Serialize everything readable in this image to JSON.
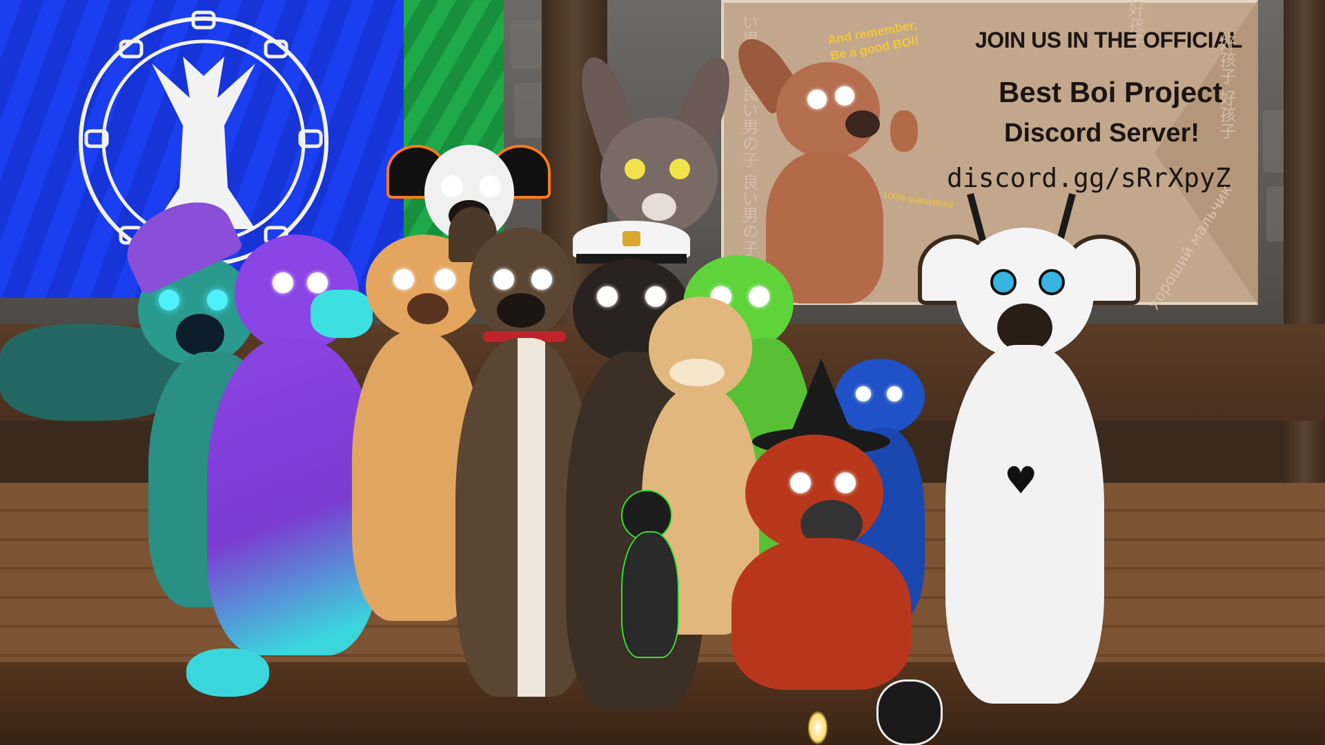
{
  "scene": {
    "description_colors": {
      "flag_blue": "#1a3ef0",
      "flag_green": "#1faa4a",
      "poster_bg": "#c2a78c",
      "stage_wood": "#7c5433"
    }
  },
  "poster": {
    "remember_line1": "And remember,",
    "remember_line2": "Be a good BOI!",
    "join_line": "JOIN US IN THE OFFICIAL",
    "project_line": "Best Boi Project",
    "server_line": "Discord Server!",
    "invite": "discord.gg/sRrXpyZ",
    "fun_note": "Fun 100% guaranteed",
    "kanji_top": "好孩子",
    "kanji_right": "好孩子 好孩子",
    "kanji_left": "い男の子 良い男の子 良い男の子",
    "cyrillic": "хороший мальчик"
  },
  "icons": {
    "flag_emblem": "wolf-silhouette-emblem-icon",
    "heart": "heart-icon",
    "cap_badge": "cap-badge-icon"
  }
}
